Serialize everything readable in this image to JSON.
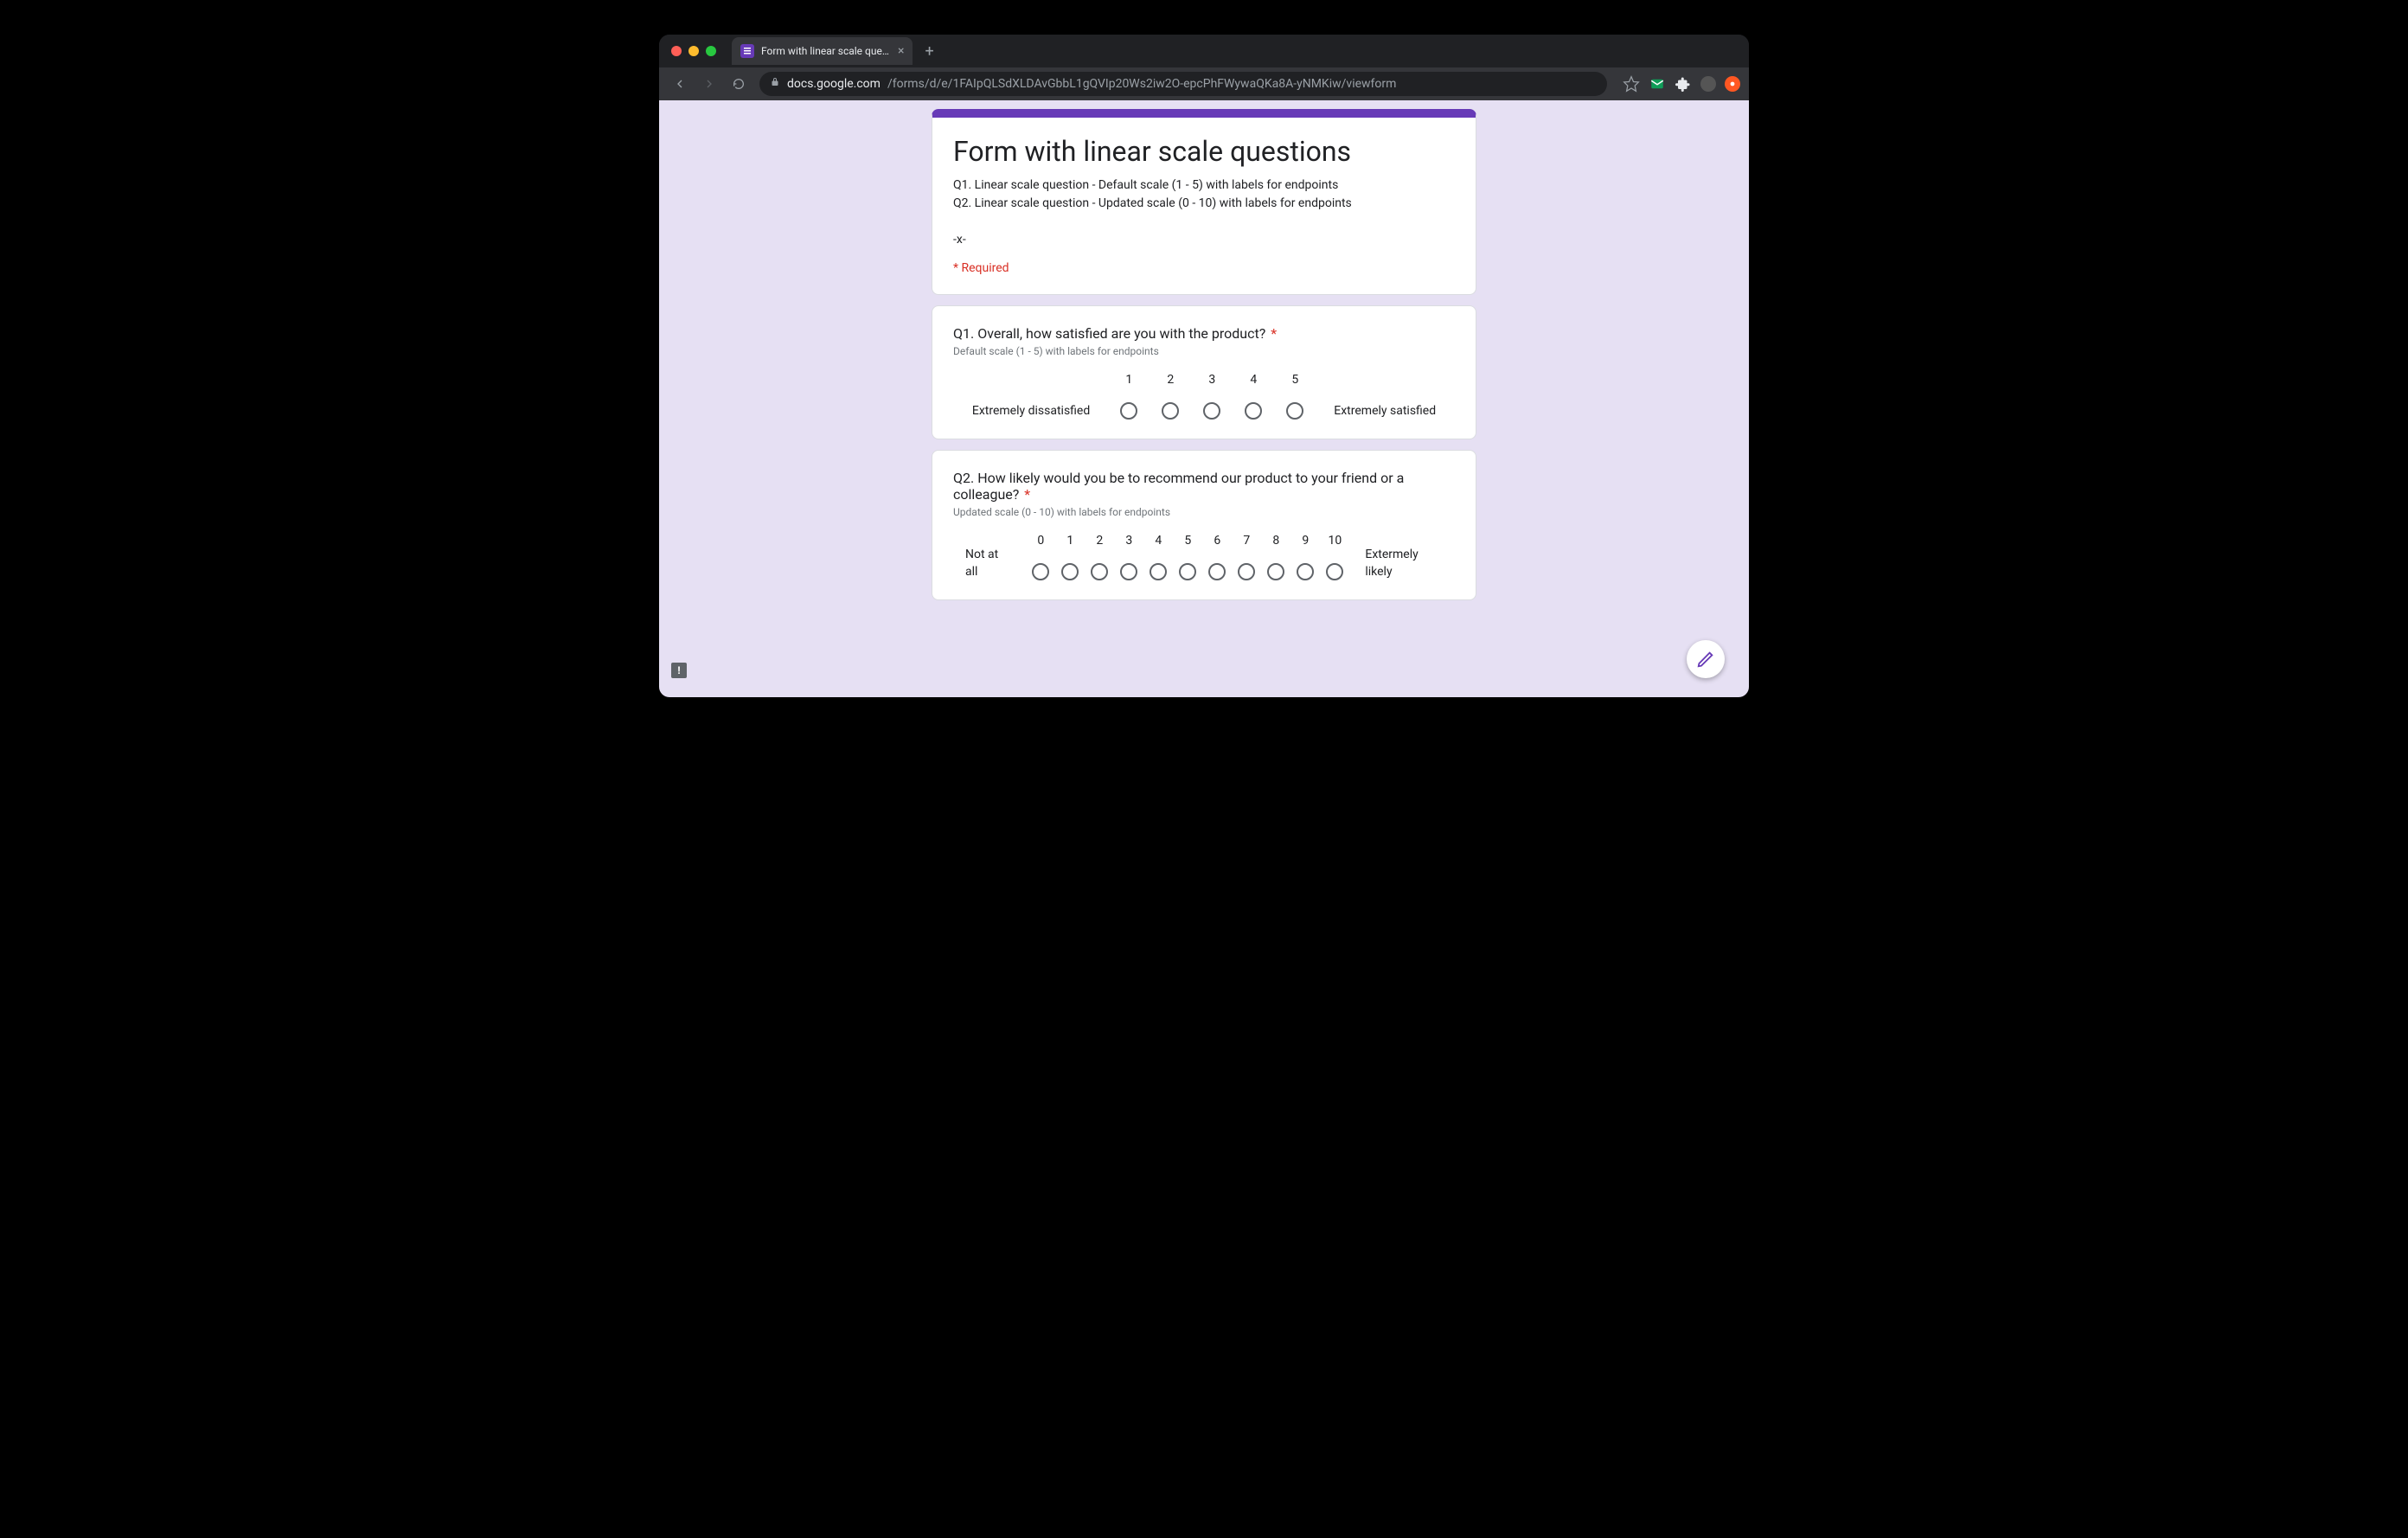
{
  "browser": {
    "tab_title": "Form with linear scale question",
    "url_host": "docs.google.com",
    "url_path": "/forms/d/e/1FAIpQLSdXLDAvGbbL1gQVIp20Ws2iw2O-epcPhFWywaQKa8A-yNMKiw/viewform"
  },
  "form": {
    "title": "Form with linear scale questions",
    "description": "Q1. Linear scale question - Default scale (1 - 5) with labels for endpoints\nQ2. Linear scale question - Updated scale (0 - 10) with labels for endpoints\n\n-x-",
    "required_note": "* Required"
  },
  "q1": {
    "title": "Q1. Overall, how satisfied are you with the product?",
    "required_marker": "*",
    "description": "Default scale (1 - 5) with labels for endpoints",
    "low_label": "Extremely dissatisfied",
    "high_label": "Extremely satisfied",
    "values": [
      "1",
      "2",
      "3",
      "4",
      "5"
    ]
  },
  "q2": {
    "title": "Q2. How likely would you be to recommend our product to your friend or a colleague?",
    "required_marker": "*",
    "description": "Updated scale (0 - 10) with labels for endpoints",
    "low_label": "Not at all",
    "high_label": "Extermely likely",
    "values": [
      "0",
      "1",
      "2",
      "3",
      "4",
      "5",
      "6",
      "7",
      "8",
      "9",
      "10"
    ]
  },
  "feedback_char": "!"
}
